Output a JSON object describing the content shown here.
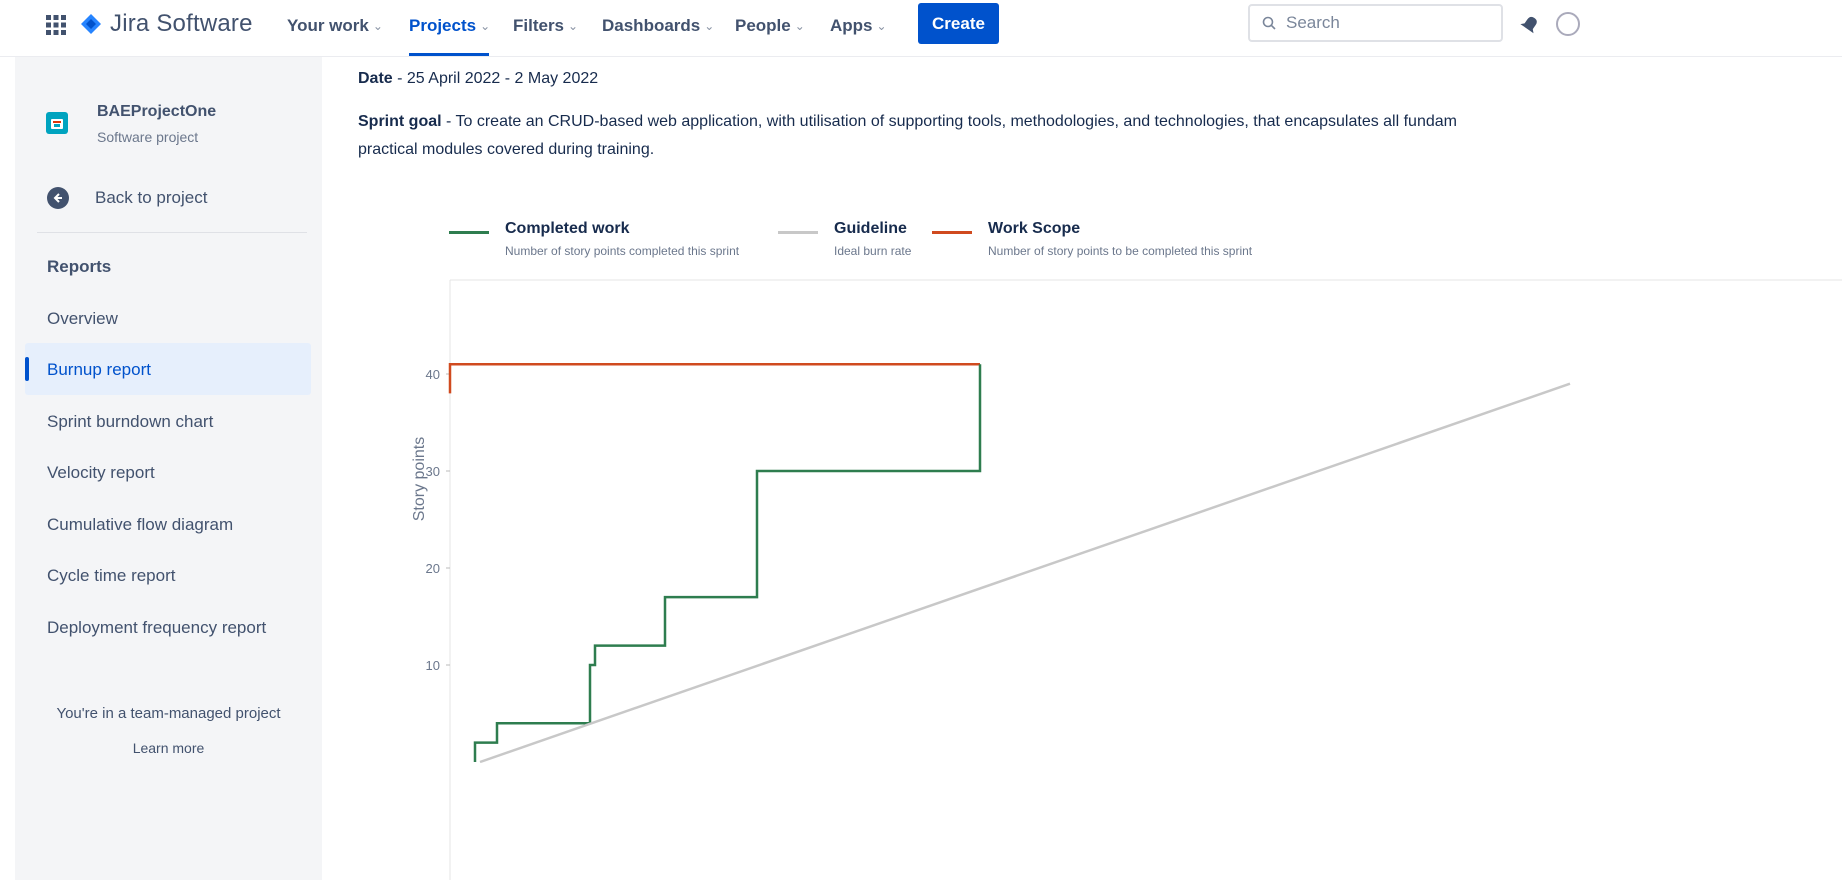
{
  "topnav": {
    "brand": "Jira Software",
    "items": [
      {
        "label": "Your work"
      },
      {
        "label": "Projects"
      },
      {
        "label": "Filters"
      },
      {
        "label": "Dashboards"
      },
      {
        "label": "People"
      },
      {
        "label": "Apps"
      }
    ],
    "create_label": "Create",
    "search_placeholder": "Search",
    "accent": "#0052cc"
  },
  "sidebar": {
    "project_name": "BAEProjectOne",
    "project_type": "Software project",
    "back_label": "Back to project",
    "section_title": "Reports",
    "items": [
      {
        "label": "Overview"
      },
      {
        "label": "Burnup report",
        "active": true
      },
      {
        "label": "Sprint burndown chart"
      },
      {
        "label": "Velocity report"
      },
      {
        "label": "Cumulative flow diagram"
      },
      {
        "label": "Cycle time report"
      },
      {
        "label": "Deployment frequency report"
      }
    ],
    "team_note": "You're in a team-managed project",
    "learn_more": "Learn more"
  },
  "main": {
    "date_label": "Date",
    "date_value": " - 25 April 2022 - 2 May 2022",
    "goal_label": "Sprint goal",
    "goal_text": " - To create an CRUD-based web application, with utilisation of supporting tools, methodologies, and technologies, that encapsulates all fundam",
    "goal_text_line2": "practical modules covered during training."
  },
  "chart_data": {
    "type": "line",
    "ylabel": "Story points",
    "yticks": [
      10,
      20,
      30,
      40
    ],
    "legend": [
      {
        "name": "Completed work",
        "description": "Number of story points completed this sprint",
        "color": "#2e7d4f"
      },
      {
        "name": "Guideline",
        "description": "Ideal burn rate",
        "color": "#c8c8c8"
      },
      {
        "name": "Work Scope",
        "description": "Number of story points to be completed this sprint",
        "color": "#d04a1f"
      }
    ],
    "series": [
      {
        "name": "Work Scope",
        "color": "#d04a1f",
        "step": true,
        "points": [
          [
            0.0,
            38
          ],
          [
            0.0,
            41
          ],
          [
            5.3,
            41
          ]
        ]
      },
      {
        "name": "Completed work",
        "color": "#2e7d4f",
        "step": true,
        "points": [
          [
            0.25,
            0
          ],
          [
            0.25,
            2
          ],
          [
            0.47,
            2
          ],
          [
            0.47,
            4
          ],
          [
            1.4,
            4
          ],
          [
            1.4,
            10
          ],
          [
            1.45,
            10
          ],
          [
            1.45,
            12
          ],
          [
            2.15,
            12
          ],
          [
            2.15,
            17
          ],
          [
            3.07,
            17
          ],
          [
            3.07,
            30
          ],
          [
            5.3,
            30
          ],
          [
            5.3,
            41
          ]
        ]
      },
      {
        "name": "Guideline",
        "color": "#c8c8c8",
        "step": false,
        "points": [
          [
            0.3,
            0
          ],
          [
            11.2,
            39
          ]
        ]
      }
    ]
  }
}
